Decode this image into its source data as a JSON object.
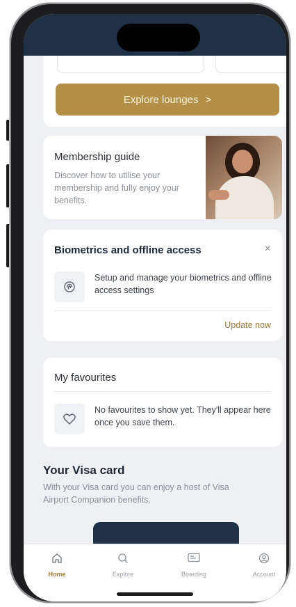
{
  "lounges": {
    "explore_label": "Explore lounges",
    "chevron": ">"
  },
  "membership_guide": {
    "title": "Membership guide",
    "description": "Discover how to utilise your membership and fully enjoy your benefits."
  },
  "biometrics": {
    "title": "Biometrics and offline access",
    "close": "×",
    "description": "Setup and manage your biometrics and offline access settings",
    "action": "Update now"
  },
  "favourites": {
    "title": "My favourites",
    "description": "No favourites to show yet. They'll appear here once you save them."
  },
  "visa": {
    "title": "Your Visa card",
    "description": "With your Visa card you can enjoy a host of Visa Airport Companion benefits."
  },
  "tabbar": {
    "items": [
      {
        "label": "Home",
        "icon": "home-icon",
        "active": true
      },
      {
        "label": "Explore",
        "icon": "search-icon",
        "active": false
      },
      {
        "label": "Boarding",
        "icon": "boarding-pass-icon",
        "active": false
      },
      {
        "label": "Account",
        "icon": "account-icon",
        "active": false
      }
    ]
  },
  "colors": {
    "navy": "#1f3146",
    "gold": "#b38f48",
    "gold_text": "#9a7a3a",
    "background": "#eef0f3"
  }
}
